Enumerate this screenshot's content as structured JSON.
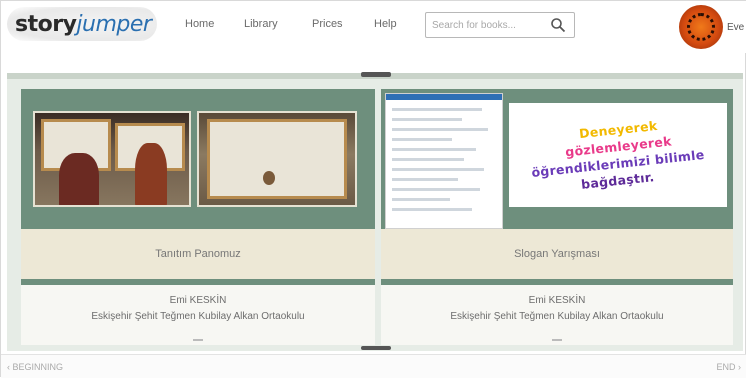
{
  "header": {
    "logo": {
      "brand_a": "story",
      "brand_b": "jumper"
    },
    "nav": [
      {
        "label": "Home"
      },
      {
        "label": "Library"
      },
      {
        "label": "Prices"
      },
      {
        "label": "Help"
      }
    ],
    "search": {
      "placeholder": "Search for books..."
    },
    "user": {
      "name": "Eve"
    }
  },
  "book": {
    "left_page": {
      "caption": "Tanıtım Panomuz",
      "author": "Emi KESKİN",
      "school": "Eskişehir Şehit Teğmen Kubilay Alkan Ortaokulu"
    },
    "right_page": {
      "caption": "Slogan Yarışması",
      "slogan_lines": [
        "Deneyerek",
        "gözlemleyerek",
        "öğrendiklerimizi bilimle",
        "bağdaştır."
      ],
      "author": "Emi KESKİN",
      "school": "Eskişehir Şehit Teğmen Kubilay Alkan Ortaokulu"
    }
  },
  "footer": {
    "left": "‹ BEGINNING",
    "right": "END ›"
  }
}
